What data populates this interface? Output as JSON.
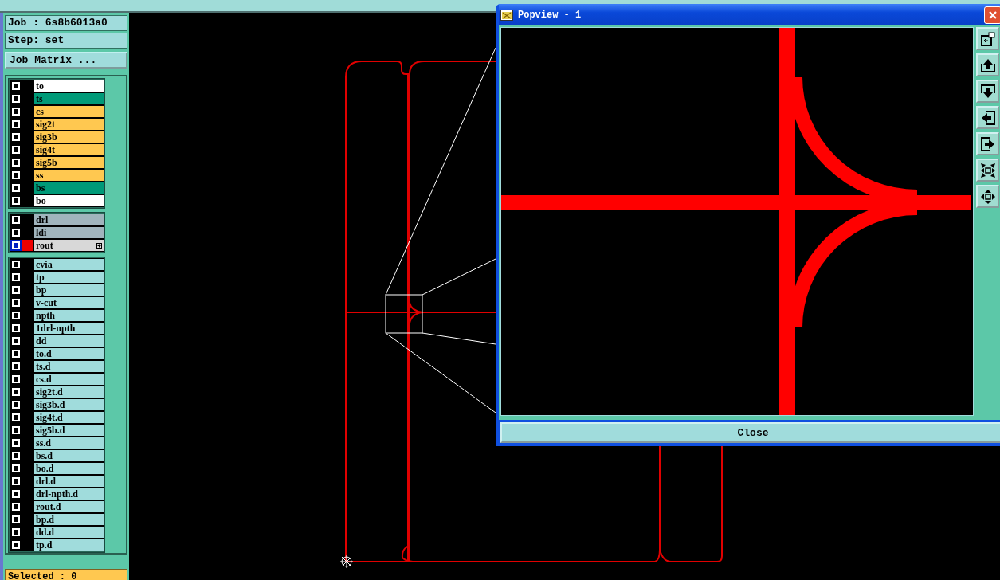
{
  "job_info": {
    "job": "Job : 6s8b6013a0",
    "step": "Step: set"
  },
  "job_matrix_button": "Job Matrix ...",
  "layer_groups": [
    {
      "layers": [
        {
          "name": "to",
          "color": "#ffffff",
          "selected": false
        },
        {
          "name": "ts",
          "color": "#009a78",
          "selected": false
        },
        {
          "name": "cs",
          "color": "#ffc850",
          "selected": false
        },
        {
          "name": "sig2t",
          "color": "#ffc850",
          "selected": false
        },
        {
          "name": "sig3b",
          "color": "#ffc850",
          "selected": false
        },
        {
          "name": "sig4t",
          "color": "#ffc850",
          "selected": false
        },
        {
          "name": "sig5b",
          "color": "#ffc850",
          "selected": false
        },
        {
          "name": "ss",
          "color": "#ffc850",
          "selected": false
        },
        {
          "name": "bs",
          "color": "#009a78",
          "selected": false
        },
        {
          "name": "bo",
          "color": "#ffffff",
          "selected": false
        }
      ]
    },
    {
      "layers": [
        {
          "name": "drl",
          "color": "#a0b4bc",
          "selected": false
        },
        {
          "name": "ldi",
          "color": "#a0b4bc",
          "selected": false
        },
        {
          "name": "rout",
          "color": "#d8d8d8",
          "selected": true
        }
      ]
    },
    {
      "layers": [
        {
          "name": "cvia",
          "color": "#a0dcdc",
          "selected": false
        },
        {
          "name": "tp",
          "color": "#a0dcdc",
          "selected": false
        },
        {
          "name": "bp",
          "color": "#a0dcdc",
          "selected": false
        },
        {
          "name": "v-cut",
          "color": "#a0dcdc",
          "selected": false
        },
        {
          "name": "npth",
          "color": "#a0dcdc",
          "selected": false
        },
        {
          "name": "1drl-npth",
          "color": "#a0dcdc",
          "selected": false
        },
        {
          "name": "dd",
          "color": "#a0dcdc",
          "selected": false
        },
        {
          "name": "to.d",
          "color": "#a0dcdc",
          "selected": false
        },
        {
          "name": "ts.d",
          "color": "#a0dcdc",
          "selected": false
        },
        {
          "name": "cs.d",
          "color": "#a0dcdc",
          "selected": false
        },
        {
          "name": "sig2t.d",
          "color": "#a0dcdc",
          "selected": false
        },
        {
          "name": "sig3b.d",
          "color": "#a0dcdc",
          "selected": false
        },
        {
          "name": "sig4t.d",
          "color": "#a0dcdc",
          "selected": false
        },
        {
          "name": "sig5b.d",
          "color": "#a0dcdc",
          "selected": false
        },
        {
          "name": "ss.d",
          "color": "#a0dcdc",
          "selected": false
        },
        {
          "name": "bs.d",
          "color": "#a0dcdc",
          "selected": false
        },
        {
          "name": "bo.d",
          "color": "#a0dcdc",
          "selected": false
        },
        {
          "name": "drl.d",
          "color": "#a0dcdc",
          "selected": false
        },
        {
          "name": "drl-npth.d",
          "color": "#a0dcdc",
          "selected": false
        },
        {
          "name": "rout.d",
          "color": "#a0dcdc",
          "selected": false
        },
        {
          "name": "bp.d",
          "color": "#a0dcdc",
          "selected": false
        },
        {
          "name": "dd.d",
          "color": "#a0dcdc",
          "selected": false
        },
        {
          "name": "tp.d",
          "color": "#a0dcdc",
          "selected": false
        }
      ]
    }
  ],
  "status": "Selected : 0",
  "popview": {
    "title": "Popview - 1",
    "close_button": "Close"
  }
}
